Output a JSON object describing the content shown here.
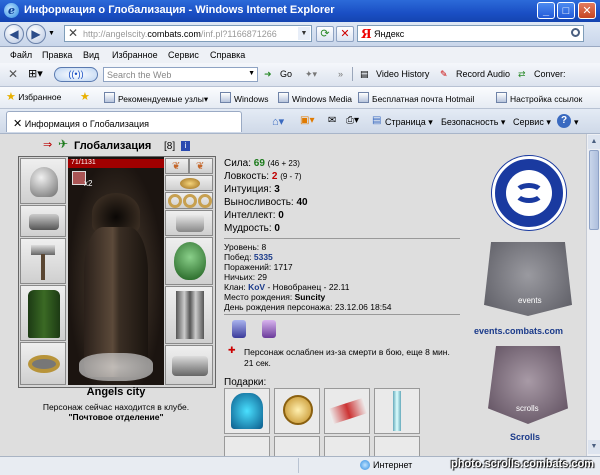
{
  "window": {
    "title": "Информация о Глобализация - Windows Internet Explorer"
  },
  "address": {
    "url_prefix": "http://angelscity.",
    "url_domain": "combats.com",
    "url_rest": "/inf.pl?1166871266"
  },
  "search": {
    "engine": "Яндекс"
  },
  "menu": [
    "Файл",
    "Правка",
    "Вид",
    "Избранное",
    "Сервис",
    "Справка"
  ],
  "toolbar": {
    "websearch_placeholder": "Search the Web",
    "go": "Go",
    "video_history": "Video History",
    "record_audio": "Record Audio",
    "convert": "Conver:"
  },
  "favorites": {
    "label": "Избранное",
    "items": [
      "Рекомендуемые узлы",
      "Windows",
      "Windows Media",
      "Бесплатная почта Hotmail",
      "Настройка ссылок"
    ]
  },
  "tab": {
    "title": "Информация о Глобализация"
  },
  "tab_tools": {
    "page": "Страница",
    "safety": "Безопасность",
    "service": "Сервис"
  },
  "character": {
    "name": "Глобализация",
    "level_badge": "[8]",
    "info_badge": "i",
    "hp": "71/1131",
    "multiplier": "x2",
    "city": "Angels city",
    "location_text": "Персонаж сейчас находится в клубе.",
    "location_name": "\"Почтовое отделение\""
  },
  "stats": {
    "strength_label": "Сила:",
    "strength": "69",
    "strength_extra": "(46 + 23)",
    "agility_label": "Ловкость:",
    "agility": "2",
    "agility_extra": "(9 - 7)",
    "intuition_label": "Интуиция:",
    "intuition": "3",
    "endurance_label": "Выносливость:",
    "endurance": "40",
    "intellect_label": "Интеллект:",
    "intellect": "0",
    "wisdom_label": "Мудрость:",
    "wisdom": "0"
  },
  "details": {
    "level_label": "Уровень:",
    "level": "8",
    "wins_label": "Побед:",
    "wins": "5335",
    "losses_label": "Поражений:",
    "losses": "1717",
    "draws_label": "Ничьих:",
    "draws": "29",
    "clan_label": "Клан:",
    "clan": "KoV",
    "clan_extra": "- Новобранец - 22.11",
    "birthplace_label": "Место рождения:",
    "birthplace": "Suncity",
    "birthday_label": "День рождения персонажа:",
    "birthday": "23.12.06 18:54",
    "weakened": "Персонаж ослаблен из-за смерти в бою, еще 8 мин. 21 сек."
  },
  "gifts_label": "Подарки:",
  "sidebar": {
    "events_label": "events",
    "events_link": "events.combats.com",
    "scrolls_label": "scrolls",
    "scrolls_link": "Scrolls"
  },
  "status": {
    "zone": "Интернет"
  },
  "watermark": "photo.scrolls.combats.com",
  "colors": {
    "ie_blue": "#1a4fc4",
    "hp_red": "#a00000",
    "stat_green": "#1a7a1a",
    "stat_red": "#c00000",
    "link_blue": "#1a3a8a"
  }
}
